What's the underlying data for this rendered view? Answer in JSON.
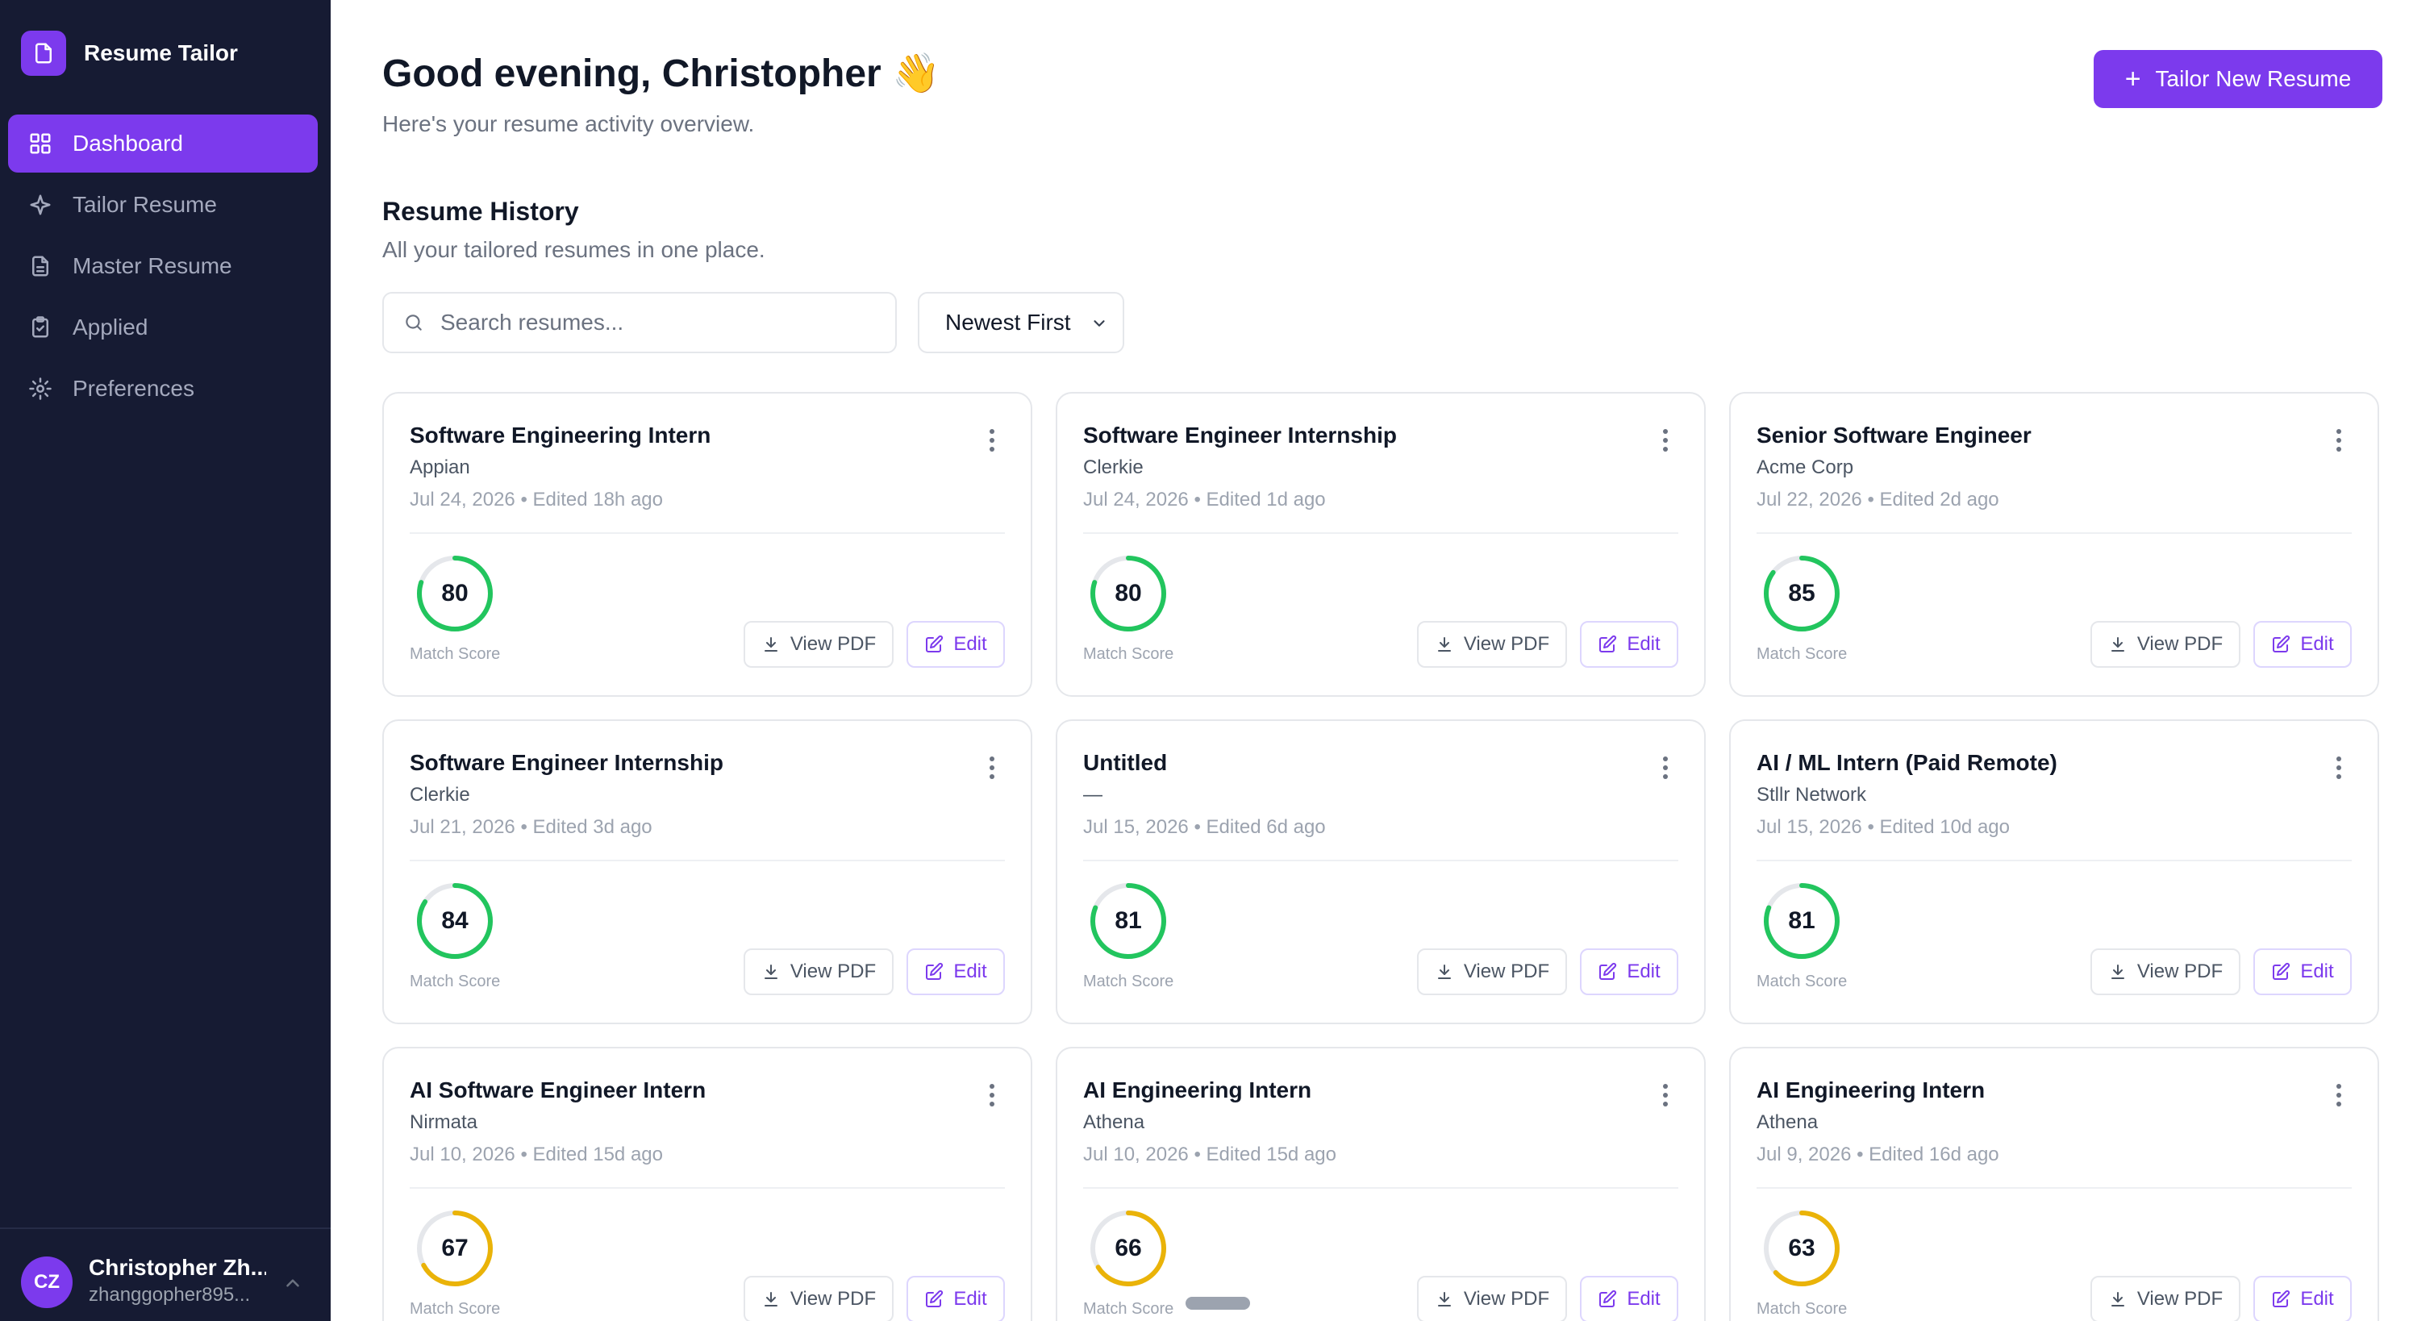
{
  "app": {
    "name": "Resume Tailor"
  },
  "sidebar": {
    "items": [
      {
        "label": "Dashboard",
        "icon": "grid-icon",
        "active": true
      },
      {
        "label": "Tailor Resume",
        "icon": "sparkle-icon",
        "active": false
      },
      {
        "label": "Master Resume",
        "icon": "document-icon",
        "active": false
      },
      {
        "label": "Applied",
        "icon": "clipboard-check-icon",
        "active": false
      },
      {
        "label": "Preferences",
        "icon": "gear-icon",
        "active": false
      }
    ]
  },
  "user": {
    "initials": "CZ",
    "name": "Christopher Zh...",
    "email": "zhanggopher895..."
  },
  "header": {
    "greeting": "Good evening, Christopher 👋",
    "subtitle": "Here's your resume activity overview.",
    "new_button_label": "Tailor New Resume"
  },
  "history": {
    "title": "Resume History",
    "subtitle": "All your tailored resumes in one place.",
    "search_placeholder": "Search resumes...",
    "sort_value": "Newest First",
    "score_label": "Match Score",
    "view_label": "View PDF",
    "edit_label": "Edit",
    "cards": [
      {
        "title": "Software Engineering Intern",
        "company": "Appian",
        "meta": "Jul 24, 2026 • Edited 18h ago",
        "score": 80
      },
      {
        "title": "Software Engineer Internship",
        "company": "Clerkie",
        "meta": "Jul 24, 2026 • Edited 1d ago",
        "score": 80
      },
      {
        "title": "Senior Software Engineer",
        "company": "Acme Corp",
        "meta": "Jul 22, 2026 • Edited 2d ago",
        "score": 85
      },
      {
        "title": "Software Engineer Internship",
        "company": "Clerkie",
        "meta": "Jul 21, 2026 • Edited 3d ago",
        "score": 84
      },
      {
        "title": "Untitled",
        "company": "—",
        "meta": "Jul 15, 2026 • Edited 6d ago",
        "score": 81
      },
      {
        "title": "AI / ML Intern (Paid Remote)",
        "company": "Stllr Network",
        "meta": "Jul 15, 2026 • Edited 10d ago",
        "score": 81
      },
      {
        "title": "AI Software Engineer Intern",
        "company": "Nirmata",
        "meta": "Jul 10, 2026 • Edited 15d ago",
        "score": 67
      },
      {
        "title": "AI Engineering Intern",
        "company": "Athena",
        "meta": "Jul 10, 2026 • Edited 15d ago",
        "score": 66
      },
      {
        "title": "AI Engineering Intern",
        "company": "Athena",
        "meta": "Jul 9, 2026 • Edited 16d ago",
        "score": 63
      }
    ]
  },
  "colors": {
    "accent": "#7c3aed",
    "sidebar_bg": "#161b33",
    "score_high": "#22c55e",
    "score_mid": "#eab308",
    "ring_track": "#e5e7eb"
  }
}
